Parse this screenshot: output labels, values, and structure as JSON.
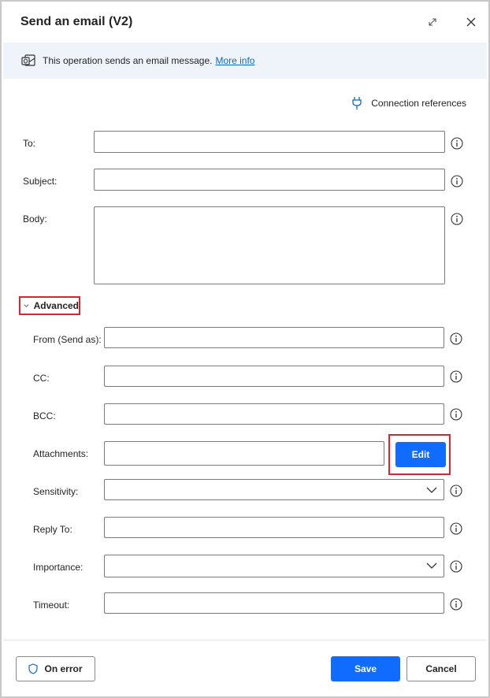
{
  "dialog": {
    "title": "Send an email (V2)"
  },
  "info_bar": {
    "text": "This operation sends an email message.",
    "link": "More info",
    "icon": "outlook-icon"
  },
  "connection_references": {
    "label": "Connection references",
    "icon": "plug-icon"
  },
  "fields": {
    "to": {
      "label": "To:",
      "value": ""
    },
    "subject": {
      "label": "Subject:",
      "value": ""
    },
    "body": {
      "label": "Body:",
      "value": ""
    }
  },
  "advanced": {
    "label": "Advanced",
    "expanded": true,
    "fields": {
      "from": {
        "label": "From (Send as):",
        "value": ""
      },
      "cc": {
        "label": "CC:",
        "value": ""
      },
      "bcc": {
        "label": "BCC:",
        "value": ""
      },
      "attachments": {
        "label": "Attachments:",
        "value": "",
        "edit_label": "Edit"
      },
      "sensitivity": {
        "label": "Sensitivity:",
        "value": ""
      },
      "reply_to": {
        "label": "Reply To:",
        "value": ""
      },
      "importance": {
        "label": "Importance:",
        "value": ""
      },
      "timeout": {
        "label": "Timeout:",
        "value": ""
      }
    }
  },
  "footer": {
    "on_error_label": "On error",
    "save_label": "Save",
    "cancel_label": "Cancel"
  },
  "colors": {
    "primary": "#0f6cff",
    "link": "#0f6cbd",
    "highlight": "#d7262f",
    "info_bar_bg": "#eff4fb"
  }
}
